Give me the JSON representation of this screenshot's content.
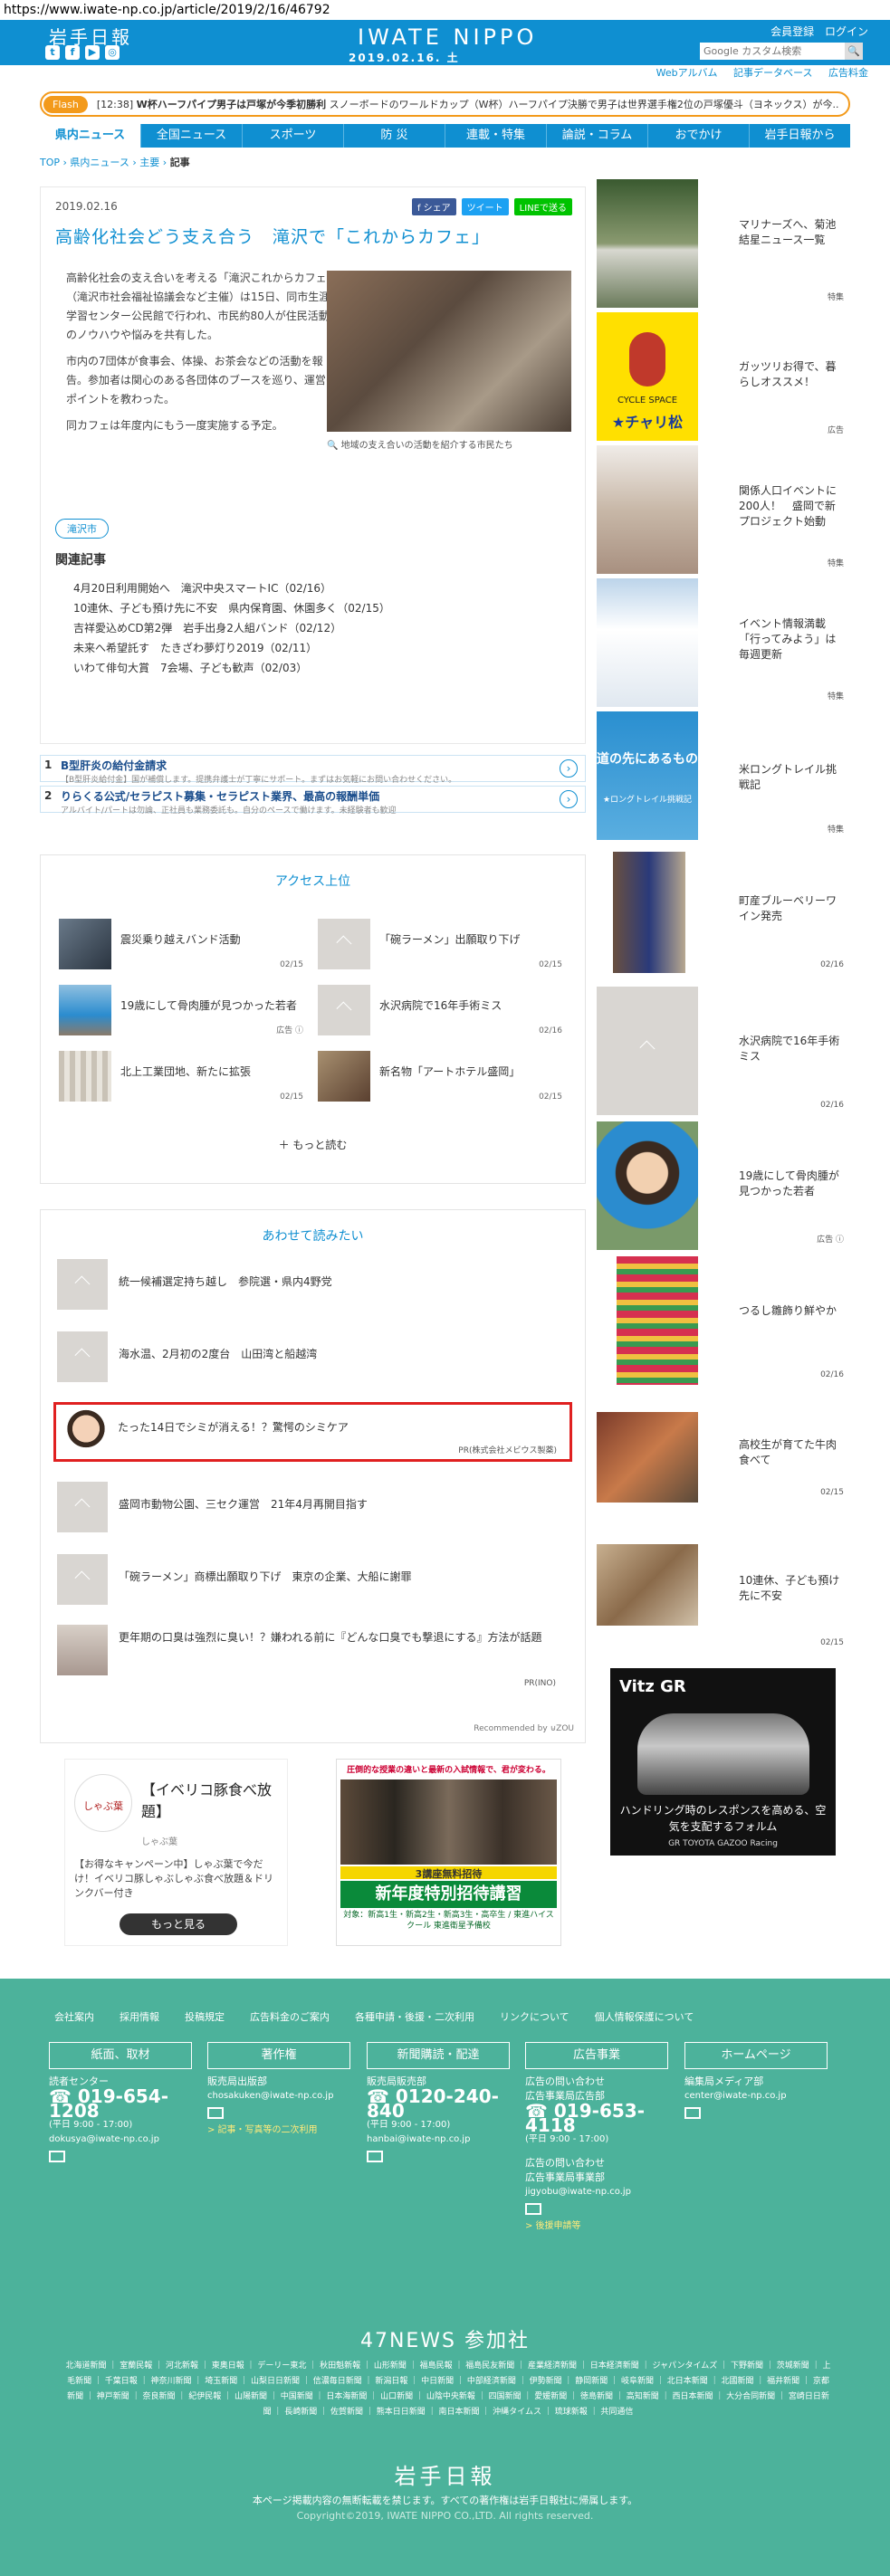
{
  "browser": {
    "url": "https://www.iwate-np.co.jp/article/2019/2/16/46792"
  },
  "header": {
    "logo_jp": "岩手日報",
    "logo_en": "IWATE NIPPO",
    "date": "2019.02.16. 土",
    "register": "会員登録",
    "login": "ログイン",
    "search_placeholder": "Google カスタム検索",
    "sublinks": [
      "Webアルバム",
      "記事データベース",
      "広告料金"
    ]
  },
  "flash": {
    "label": "Flash",
    "time": "[12:38]",
    "headline": "W杯ハーフパイプ男子は戸塚が今季初勝利",
    "text": "スノーボードのワールドカップ（W杯）ハーフパイプ決勝で男子は世界選手権2位の戸塚優斗（ヨネックス）が今..."
  },
  "nav": [
    "県内ニュース",
    "全国ニュース",
    "スポーツ",
    "防 災",
    "連載・特集",
    "論説・コラム",
    "おでかけ",
    "岩手日報から"
  ],
  "breadcrumb": {
    "top": "TOP",
    "sep": "›",
    "c1": "県内ニュース",
    "c2": "主要",
    "current": "記事"
  },
  "article": {
    "date": "2019.02.16",
    "share": {
      "fb": "f シェア",
      "tw": "ツイート",
      "line": "LINEで送る"
    },
    "title": "高齢化社会どう支え合う　滝沢で「これからカフェ」",
    "p1": "高齢化社会の支え合いを考える「滝沢これからカフェ」（滝沢市社会福祉協議会など主催）は15日、同市生涯学習センター公民館で行われ、市民約80人が住民活動のノウハウや悩みを共有した。",
    "p2": "市内の7団体が食事会、体操、お茶会などの活動を報告。参加者は関心のある各団体のブースを巡り、運営のポイントを教わった。",
    "p3": "同カフェは年度内にもう一度実施する予定。",
    "caption": "🔍 地域の支え合いの活動を紹介する市民たち",
    "tag": "滝沢市",
    "related_heading": "関連記事",
    "related": [
      "4月20日利用開始へ　滝沢中央スマートIC（02/16）",
      "10連休、子ども預け先に不安　県内保育園、休園多く（02/15）",
      "吉祥愛込めCD第2弾　岩手出身2人組バンド（02/12）",
      "未来へ希望託す　たきざわ夢灯り2019（02/11）",
      "いわて俳句大賞　7会場、子ども歓声（02/03）"
    ]
  },
  "text_ads": [
    {
      "n": "1",
      "title": "B型肝炎の給付金請求",
      "sub": "【B型肝炎給付金】国が補償します。提携弁護士が丁寧にサポート。まずはお気軽にお問い合わせください。"
    },
    {
      "n": "2",
      "title": "りらくる公式/セラピスト募集・セラピスト業界、最高の報酬単価",
      "sub": "アルバイト/パートは勿論、正社員も業務委託も。自分のペースで働けます。未経験者も歓迎"
    }
  ],
  "access": {
    "heading": "アクセス上位",
    "items": [
      {
        "title": "震災乗り越えバンド活動",
        "date": "02/15"
      },
      {
        "title": "「碗ラーメン」出願取り下げ",
        "date": "02/15"
      },
      {
        "title": "19歳にして骨肉腫が見つかった若者",
        "date": "広告 ⓘ"
      },
      {
        "title": "水沢病院で16年手術ミス",
        "date": "02/16"
      },
      {
        "title": "北上工業団地、新たに拡張",
        "date": "02/15"
      },
      {
        "title": "新名物「アートホテル盛岡」",
        "date": "02/15"
      }
    ],
    "more": "もっと読む"
  },
  "read_also": {
    "heading": "あわせて読みたい",
    "items": [
      {
        "title": "統一候補選定持ち越し　参院選・県内4野党",
        "pr": ""
      },
      {
        "title": "海水温、2月初の2度台　山田湾と船越湾",
        "pr": ""
      },
      {
        "title": "たった14日でシミが消える！？驚愕のシミケア",
        "pr": "PR(株式会社メビウス製薬)"
      },
      {
        "title": "盛岡市動物公園、三セク運営　21年4月再開目指す",
        "pr": ""
      },
      {
        "title": "「碗ラーメン」商標出願取り下げ　東京の企業、大船に謝罪",
        "pr": ""
      },
      {
        "title": "更年期の口臭は強烈に臭い！？嫌われる前に『どんな口臭でも撃退にする』方法が話題",
        "pr": "PR(INO)"
      }
    ],
    "powered": "Recommended by ⊍ZOU"
  },
  "ad_shabu": {
    "logo": "しゃぶ葉",
    "title": "【イベリコ豚食べ放題】",
    "brand": "しゃぶ葉",
    "body": "【お得なキャンペーン中】しゃぶ葉で今だけ！イベリコ豚しゃぶしゃぶ食べ放題＆ドリンクバー付き",
    "button": "もっと見る"
  },
  "ad_school": {
    "top": "圧倒的な授業の違いと最新の入試情報で、君が変わる。",
    "band": "3講座無料招待",
    "big": "新年度特別招待講習",
    "small": "対象：新高1生・新高2生・新高3生・高卒生 / 東進ハイスクール 東進衛星予備校"
  },
  "sidebar": [
    {
      "title": "マリナーズへ、菊池結星ニュース一覧",
      "date": "特集"
    },
    {
      "title": "ガッツリお得で、暮らしオススメ！",
      "date": "広告"
    },
    {
      "title": "関係人口イベントに200人！　盛岡で新プロジェクト始動",
      "date": "特集"
    },
    {
      "title": "イベント情報満載「行ってみよう」は毎週更新",
      "date": "特集"
    },
    {
      "title": "米ロングトレイル挑戦記",
      "date": "特集"
    },
    {
      "title": "町産ブルーベリーワイン発売",
      "date": "02/16"
    },
    {
      "title": "水沢病院で16年手術ミス",
      "date": "02/16"
    },
    {
      "title": "19歳にして骨肉腫が見つかった若者",
      "date": "広告 ⓘ"
    },
    {
      "title": "つるし雛飾り鮮やか",
      "date": "02/16"
    },
    {
      "title": "高校生が育てた牛肉食べて",
      "date": "02/15"
    },
    {
      "title": "10連休、子ども預け先に不安",
      "date": "02/15"
    }
  ],
  "side_labels": {
    "chari": "★チャリ松",
    "chari_top": "CYCLE SPACE",
    "trail": "道の先にあるもの",
    "trail_sub": "★ロングトレイル挑戦記"
  },
  "car_ad": {
    "title": "Vitz GR",
    "copy": "ハンドリング時のレスポンスを高める、空気を支配するフォルム",
    "brand": "GR TOYOTA GAZOO Racing"
  },
  "footer": {
    "links": [
      "会社案内",
      "採用情報",
      "投稿規定",
      "広告料金のご案内",
      "各種申請・後援・二次利用",
      "リンクについて",
      "個人情報保護について"
    ],
    "boxes": [
      "紙面、取材",
      "著作権",
      "新聞購読・配達",
      "広告事業",
      "ホームページ"
    ],
    "c1": {
      "label": "読者センター",
      "phone": "019-654-1208",
      "hours": "(平日 9:00 - 17:00)",
      "mail": "dokusya@iwate-np.co.jp"
    },
    "c2": {
      "label": "販売局出版部",
      "mail": "chosakuken@iwate-np.co.jp",
      "link": "> 記事・写真等の二次利用"
    },
    "c3": {
      "label": "販売局販売部",
      "phone": "0120-240-840",
      "hours": "(平日 9:00 - 17:00)",
      "mail": "hanbai@iwate-np.co.jp"
    },
    "c4": {
      "label1": "広告の問い合わせ",
      "label2": "広告事業局広告部",
      "phone": "019-653-4118",
      "hours": "(平日 9:00 - 17:00)",
      "label3": "広告の問い合わせ",
      "label4": "広告事業局事業部",
      "mail": "jigyobu@iwate-np.co.jp",
      "link": "> 後援申請等"
    },
    "c5": {
      "label": "編集局メディア部",
      "mail": "center@iwate-np.co.jp"
    },
    "news47": "47NEWS 参加社",
    "papers": "北海道新聞 ｜ 室蘭民報 ｜ 河北新報 ｜ 東奥日報 ｜ デーリー東北 ｜ 秋田魁新報 ｜ 山形新聞 ｜ 福島民報 ｜ 福島民友新聞 ｜ 産業経済新聞 ｜ 日本経済新聞 ｜ ジャパンタイムズ ｜ 下野新聞 ｜ 茨城新聞 ｜ 上毛新聞 ｜ 千葉日報 ｜ 神奈川新聞 ｜ 埼玉新聞 ｜ 山梨日日新聞 ｜ 信濃毎日新聞 ｜ 新潟日報 ｜ 中日新聞 ｜ 中部経済新聞 ｜ 伊勢新聞 ｜ 静岡新聞 ｜ 岐阜新聞 ｜ 北日本新聞 ｜ 北國新聞 ｜ 福井新聞 ｜ 京都新聞 ｜ 神戸新聞 ｜ 奈良新聞 ｜ 紀伊民報 ｜ 山陽新聞 ｜ 中国新聞 ｜ 日本海新聞 ｜ 山口新聞 ｜ 山陰中央新報 ｜ 四国新聞 ｜ 愛媛新聞 ｜ 徳島新聞 ｜ 高知新聞 ｜ 西日本新聞 ｜ 大分合同新聞 ｜ 宮崎日日新聞 ｜ 長崎新聞 ｜ 佐賀新聞 ｜ 熊本日日新聞 ｜ 南日本新聞 ｜ 沖縄タイムス ｜ 琉球新報 ｜ 共同通信",
    "logo": "岩手日報",
    "notice": "本ページ掲載内容の無断転載を禁じます。すべての著作権は岩手日報社に帰属します。",
    "copyright": "Copyright©2019, IWATE NIPPO CO.,LTD. All rights reserved."
  }
}
